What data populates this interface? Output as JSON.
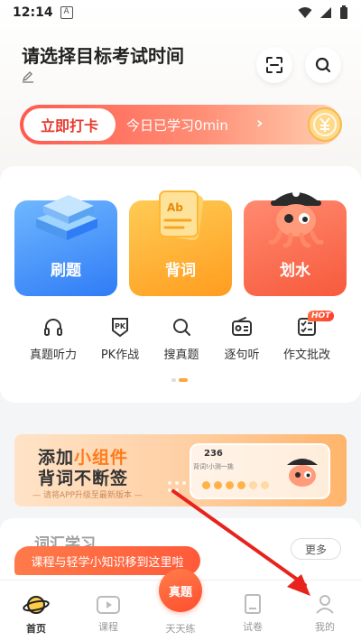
{
  "status_bar": {
    "time": "12:14",
    "indicator": "A"
  },
  "header": {
    "title": "请选择目标考试时间",
    "icons": [
      "edit-icon",
      "scan-icon",
      "search-icon"
    ]
  },
  "checkin": {
    "button_label": "立即打卡",
    "study_text": "今日已学习0min",
    "arrow": "›"
  },
  "tiles": [
    {
      "label": "刷题",
      "color": "#2f7cf6"
    },
    {
      "label": "背词",
      "color": "#ff9d1f"
    },
    {
      "label": "划水",
      "color": "#f75a3c"
    }
  ],
  "features": [
    {
      "label": "真题听力",
      "icon": "headphones-icon"
    },
    {
      "label": "PK作战",
      "icon": "pk-icon"
    },
    {
      "label": "搜真题",
      "icon": "search-icon"
    },
    {
      "label": "逐句听",
      "icon": "radio-icon"
    },
    {
      "label": "作文批改",
      "icon": "checklist-icon"
    }
  ],
  "hot_badge": "HOT",
  "widget_banner": {
    "title_prefix": "添加",
    "title_highlight": "小组件",
    "title_line2": "背词不断签",
    "subtitle": "— 请将APP升级至最新版本 —",
    "count": "236",
    "mini_text": "背词!小测一挑"
  },
  "section": {
    "title": "词汇学习",
    "more_label": "更多"
  },
  "tooltip": "课程与轻学小知识移到这里啦",
  "tabbar": {
    "items": [
      {
        "label": "首页",
        "icon": "home-planet-icon",
        "active": true
      },
      {
        "label": "课程",
        "icon": "video-icon",
        "active": false
      },
      {
        "label": "天天练",
        "icon": "practice-icon",
        "active": false,
        "center_text": "真题"
      },
      {
        "label": "试卷",
        "icon": "paper-icon",
        "active": false
      },
      {
        "label": "我的",
        "icon": "profile-icon",
        "active": false
      }
    ]
  },
  "colors": {
    "accent": "#ff5a3a",
    "arrow": "#e8231c",
    "highlight": "#ff7a1a"
  }
}
